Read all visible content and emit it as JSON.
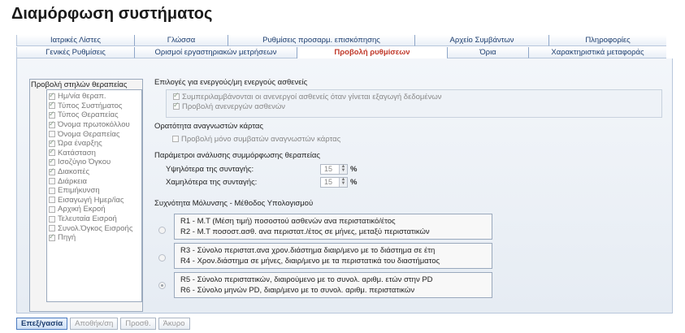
{
  "page_title": "Διαμόρφωση συστήματος",
  "tabs_row1": [
    "Ιατρικές Λίστες",
    "Γλώσσα",
    "Ρυθμίσεις προσαρμ. επισκόπησης",
    "Αρχείο Συμβάντων",
    "Πληροφορίες"
  ],
  "tabs_row2": [
    "Γενικές Ρυθμίσεις",
    "Ορισμοί εργαστηριακών μετρήσεων",
    "Προβολή ρυθμίσεων",
    "Όρια",
    "Χαρακτηριστικά μεταφοράς"
  ],
  "active_tab": "Προβολή ρυθμίσεων",
  "column_list": {
    "title": "Προβολή στηλών θεραπείας",
    "items": [
      {
        "label": "Ημ/νία θεραπ.",
        "checked": true
      },
      {
        "label": "Τύπος Συστήματος",
        "checked": true
      },
      {
        "label": "Τύπος Θεραπείας",
        "checked": true
      },
      {
        "label": "Όνομα πρωτοκόλλου",
        "checked": true
      },
      {
        "label": "Όνομα Θεραπείας",
        "checked": false
      },
      {
        "label": "Ώρα έναρξης",
        "checked": true
      },
      {
        "label": "Κατάσταση",
        "checked": true
      },
      {
        "label": "Ισοζύγιο Όγκου",
        "checked": true
      },
      {
        "label": "Διακοπές",
        "checked": true
      },
      {
        "label": "Διάρκεια",
        "checked": false
      },
      {
        "label": "Επιμήκυνση",
        "checked": false
      },
      {
        "label": "Εισαγωγή Ημερ/ίας",
        "checked": false
      },
      {
        "label": "Αρχική Εκροή",
        "checked": false
      },
      {
        "label": "Τελευταία Εισροή",
        "checked": false
      },
      {
        "label": "Συνολ.Όγκος Εισροής",
        "checked": false
      },
      {
        "label": "Πηγή",
        "checked": true
      }
    ]
  },
  "active_patients": {
    "title": "Επιλογές για ενεργούς/μη ενεργούς ασθενείς",
    "opt1": "Συμπεριλαμβάνονται οι ανενεργοί ασθενείς όταν γίνεται εξαγωγή δεδομένων",
    "opt2": "Προβολή ανενεργών ασθενών"
  },
  "card_visibility": {
    "title": "Ορατότητα αναγνωστών κάρτας",
    "opt1": "Προβολή μόνο συμβατών αναγνωστών κάρτας"
  },
  "compliance": {
    "title": "Παράμετροι ανάλυσης συμμόρφωσης θεραπείας",
    "upper_label": "Υψηλότερα της συνταγής:",
    "upper_value": "15",
    "lower_label": "Χαμηλότερα της συνταγής:",
    "lower_value": "15",
    "unit": "%"
  },
  "infection": {
    "title": "Συχνότητα Μόλυνσης - Μέθοδος Υπολογισμού",
    "options": [
      {
        "line1": "R1 - Μ.Τ (Μέση τιμή) ποσοστού ασθενών ανα περιστατικό/έτος",
        "line2": "R2 - Μ.Τ ποσοστ.ασθ. ανα περιστατ./έτος σε μήνες, μεταξύ περιστατικών",
        "selected": false
      },
      {
        "line1": "R3 - Σύνολο περιστατ.ανα χρον.διάστημα διαιρ/μενο με το διάστημα σε έτη",
        "line2": "R4 - Χρον.διάστημα σε μήνες, διαιρ/μενο με τα περιστατικά του διαστήματος",
        "selected": false
      },
      {
        "line1": "R5 - Σύνολο περιστατικών, διαιρούμενο με το συνολ. αριθμ. ετών στην PD",
        "line2": "R6 - Σύνολο μηνών PD, διαιρ/μενο με το συνολ. αριθμ. περιστατικών",
        "selected": true
      }
    ]
  },
  "buttons": {
    "edit": "Επεξ/γασία",
    "save": "Αποθήκ/ση",
    "add": "Προσθ.",
    "cancel": "Άκυρο"
  }
}
